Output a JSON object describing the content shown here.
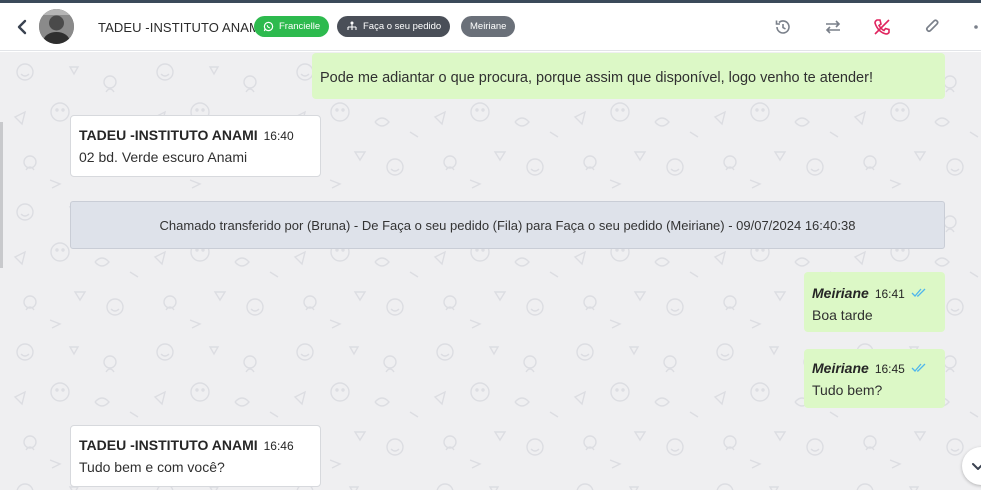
{
  "header": {
    "contact_name": "TADEU -INSTITUTO ANAMI",
    "tags": {
      "agent": "Francielle",
      "queue": "Faça o seu pedido",
      "user": "Meiriane"
    },
    "icons": [
      "back-icon",
      "history-icon",
      "transfer-icon",
      "end-call-icon",
      "attach-icon",
      "more-icon"
    ]
  },
  "messages": [
    {
      "direction": "out",
      "text": "Pode me adiantar o que procura, porque assim que disponível, logo venho te atender!"
    },
    {
      "direction": "in",
      "sender": "TADEU -INSTITUTO ANAMI",
      "time": "16:40",
      "text": "02 bd. Verde escuro Anami"
    },
    {
      "direction": "system",
      "text": "Chamado transferido por (Bruna) - De Faça o seu pedido (Fila) para Faça o seu pedido (Meiriane) - 09/07/2024 16:40:38"
    },
    {
      "direction": "out",
      "sender": "Meiriane",
      "time": "16:41",
      "text": "Boa tarde",
      "status": "read"
    },
    {
      "direction": "out",
      "sender": "Meiriane",
      "time": "16:45",
      "text": "Tudo bem?",
      "status": "read"
    },
    {
      "direction": "in",
      "sender": "TADEU -INSTITUTO ANAMI",
      "time": "16:46",
      "text": "Tudo bem e com você?"
    }
  ],
  "colors": {
    "outgoing_bubble": "#dcf8c6",
    "incoming_bubble": "#ffffff",
    "system_notice": "#dee2ea",
    "chat_background": "#efeff1",
    "agent_tag": "#2dba4e",
    "read_check": "#4fb6ec",
    "end_call_icon": "#e0245e"
  }
}
